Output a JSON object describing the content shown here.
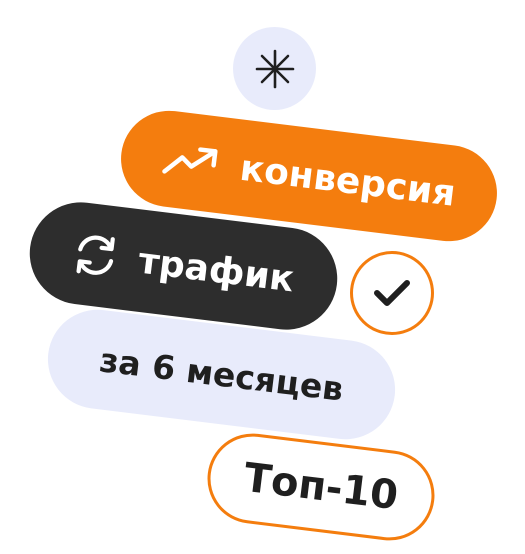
{
  "colors": {
    "accent_orange": "#f47d0e",
    "dark": "#2d2d2d",
    "light_lavender": "#e8ebfb",
    "text_dark": "#1f1f1f",
    "white": "#ffffff"
  },
  "badges": {
    "top_icon": "asterisk-icon",
    "check_icon": "checkmark-icon"
  },
  "tags": {
    "conversion": {
      "label": "конверсия",
      "icon": "trending-up-icon"
    },
    "traffic": {
      "label": "трафик",
      "icon": "refresh-icon"
    },
    "period": {
      "label": "за 6 месяцев"
    },
    "top": {
      "label": "Топ-10"
    }
  }
}
